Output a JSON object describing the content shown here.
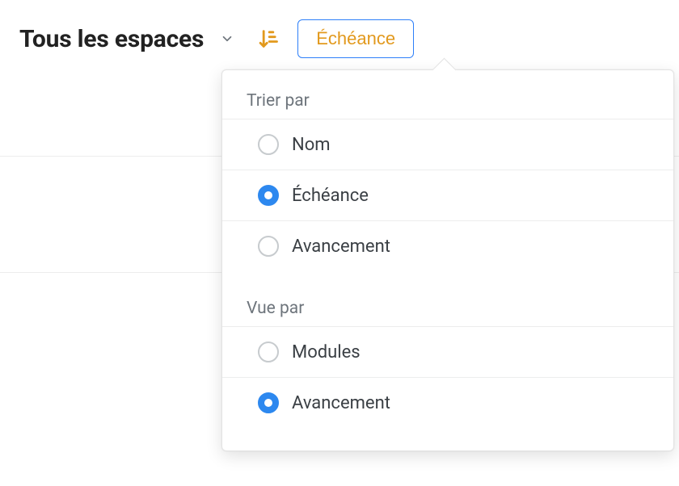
{
  "header": {
    "title": "Tous les espaces",
    "filter_button_label": "Échéance"
  },
  "menu": {
    "sort_section_label": "Trier par",
    "view_section_label": "Vue par",
    "sort_options": [
      {
        "label": "Nom",
        "checked": false
      },
      {
        "label": "Échéance",
        "checked": true
      },
      {
        "label": "Avancement",
        "checked": false
      }
    ],
    "view_options": [
      {
        "label": "Modules",
        "checked": false
      },
      {
        "label": "Avancement",
        "checked": true
      }
    ]
  },
  "colors": {
    "accent_blue": "#2d88ef",
    "chip_border": "#2d7ff9",
    "chip_text": "#e2991d",
    "sort_icon": "#e2991d"
  }
}
